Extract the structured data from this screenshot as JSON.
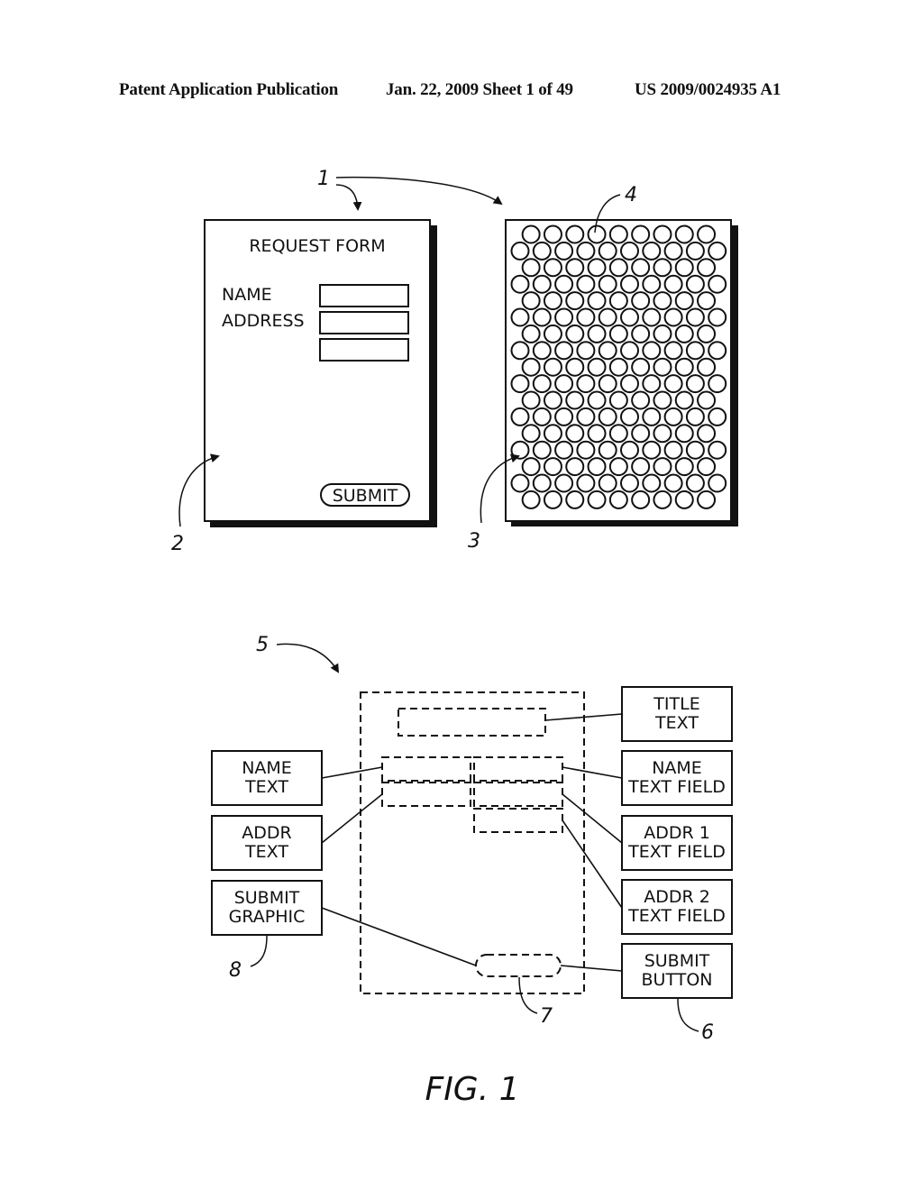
{
  "header": {
    "publication": "Patent Application Publication",
    "date_sheet": "Jan. 22, 2009  Sheet 1 of 49",
    "patent_number": "US 2009/0024935 A1"
  },
  "top_figure": {
    "reference_labels": {
      "group": "1",
      "form_page": "2",
      "dot_pattern_page": "3",
      "dot": "4"
    },
    "form": {
      "title": "REQUEST FORM",
      "name_label": "NAME",
      "address_label": "ADDRESS",
      "name_field_value": "",
      "address1_field_value": "",
      "address2_field_value": "",
      "submit_label": "SUBMIT"
    },
    "dot_pattern": {
      "rows": 17,
      "long_row_count": 10,
      "short_row_count": 9,
      "first_row": "short"
    }
  },
  "bottom_figure": {
    "reference_labels": {
      "description": "5",
      "submit_button": "6",
      "submit_zone": "7",
      "submit_graphic": "8"
    },
    "left_boxes": [
      {
        "id": "name-text",
        "lines": [
          "NAME",
          "TEXT"
        ]
      },
      {
        "id": "addr-text",
        "lines": [
          "ADDR",
          "TEXT"
        ]
      },
      {
        "id": "submit-graphic",
        "lines": [
          "SUBMIT",
          "GRAPHIC"
        ]
      }
    ],
    "right_boxes": [
      {
        "id": "title-text",
        "lines": [
          "TITLE",
          "TEXT"
        ]
      },
      {
        "id": "name-text-field",
        "lines": [
          "NAME",
          "TEXT FIELD"
        ]
      },
      {
        "id": "addr1-text-field",
        "lines": [
          "ADDR 1",
          "TEXT FIELD"
        ]
      },
      {
        "id": "addr2-text-field",
        "lines": [
          "ADDR 2",
          "TEXT FIELD"
        ]
      },
      {
        "id": "submit-button",
        "lines": [
          "SUBMIT",
          "BUTTON"
        ]
      }
    ]
  },
  "caption": "FIG. 1"
}
